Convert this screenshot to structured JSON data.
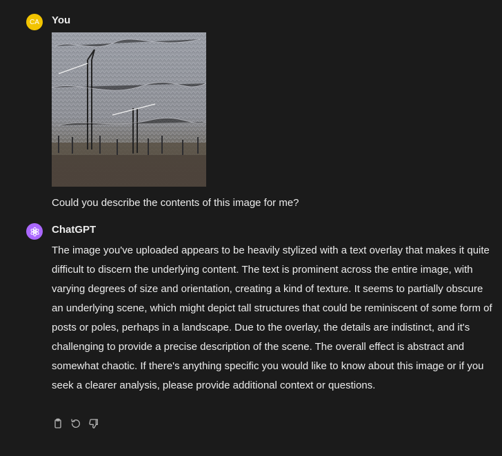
{
  "conversation": {
    "user": {
      "avatar_initials": "CA",
      "name": "You",
      "text": "Could you describe the contents of this image for me?"
    },
    "assistant": {
      "name": "ChatGPT",
      "paragraph": "The image you've uploaded appears to be heavily stylized with a text overlay that makes it quite difficult to discern the underlying content. The text is prominent across the entire image, with varying degrees of size and orientation, creating a kind of texture. It seems to partially obscure an underlying scene, which might depict tall structures that could be reminiscent of some form of posts or poles, perhaps in a landscape. Due to the overlay, the details are indistinct, and it's challenging to provide a precise description of the scene. The overall effect is abstract and somewhat chaotic. If there's anything specific you would like to know about this image or if you seek a clearer analysis, please provide additional context or questions."
    }
  },
  "icons": {
    "copy": "clipboard-icon",
    "regenerate": "regenerate-icon",
    "dislike": "thumbs-down-icon"
  },
  "colors": {
    "background": "#1b1b1b",
    "user_avatar": "#f2c400",
    "assistant_avatar": "#ab68ff",
    "text": "#ececec",
    "icon": "#b4b4b4"
  }
}
